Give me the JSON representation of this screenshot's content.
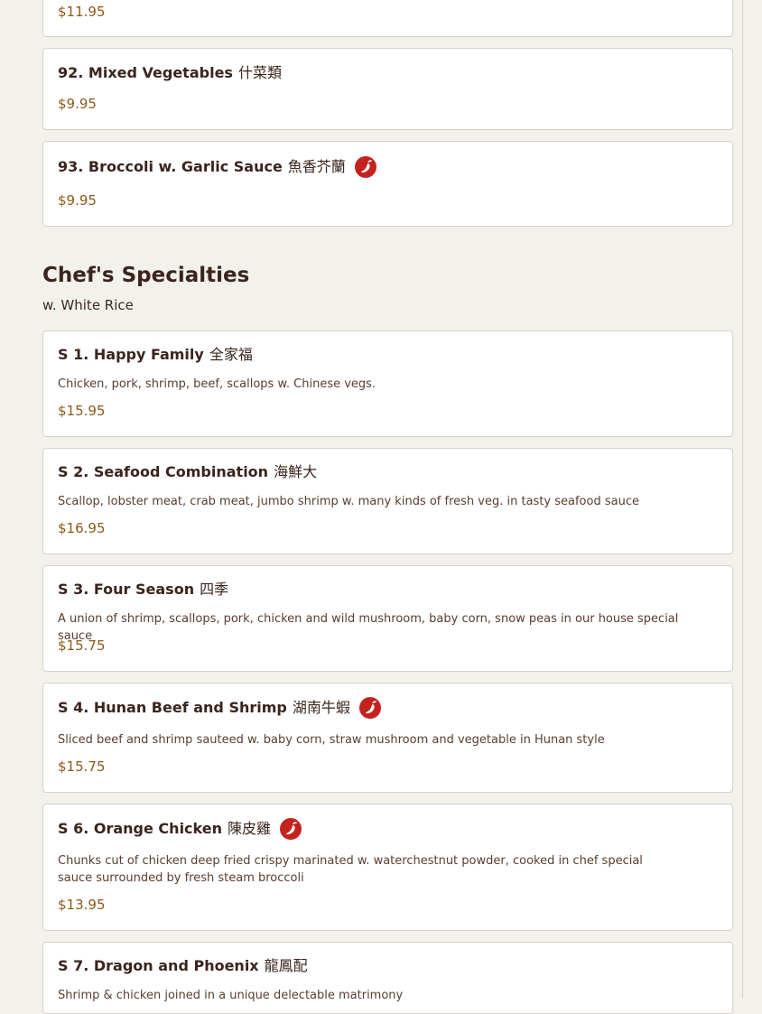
{
  "icons": {
    "spicy": "chili-pepper-icon"
  },
  "colors": {
    "spicy_badge": "#c4221f",
    "price": "#8a5a19",
    "title": "#3a241c"
  },
  "prev_items": [
    {
      "price": "$11.95"
    },
    {
      "name": "92. Mixed Vegetables",
      "cn": "什菜類",
      "price": "$9.95"
    },
    {
      "name": "93. Broccoli w. Garlic Sauce",
      "cn": "魚香芥蘭",
      "price": "$9.95",
      "spicy": true
    }
  ],
  "section": {
    "title": "Chef's Specialties",
    "subtitle": "w. White Rice",
    "items": [
      {
        "name": "S 1. Happy Family",
        "cn": "全家福",
        "desc": "Chicken, pork, shrimp, beef, scallops w. Chinese vegs.",
        "price": "$15.95"
      },
      {
        "name": "S 2. Seafood Combination",
        "cn": "海鮮大",
        "desc": "Scallop, lobster meat, crab meat, jumbo shrimp w. many kinds of fresh veg. in tasty seafood sauce",
        "price": "$16.95"
      },
      {
        "name": "S 3. Four Season",
        "cn": "四季",
        "desc": "A union of shrimp, scallops, pork, chicken and wild mushroom, baby corn, snow peas in our house special sauce",
        "price": "$15.75"
      },
      {
        "name": "S 4. Hunan Beef and Shrimp",
        "cn": "湖南牛蝦",
        "desc": "Sliced beef and shrimp sauteed w. baby corn, straw mushroom and vegetable in Hunan style",
        "price": "$15.75",
        "spicy": true
      },
      {
        "name": "S 6. Orange Chicken",
        "cn": "陳皮雞",
        "desc": "Chunks cut of chicken deep fried crispy marinated w. waterchestnut powder, cooked in chef special sauce surrounded by fresh steam broccoli",
        "price": "$13.95",
        "spicy": true
      },
      {
        "name": "S 7. Dragon and Phoenix",
        "cn": "龍鳳配",
        "desc": "Shrimp & chicken joined in a unique delectable matrimony"
      }
    ]
  }
}
